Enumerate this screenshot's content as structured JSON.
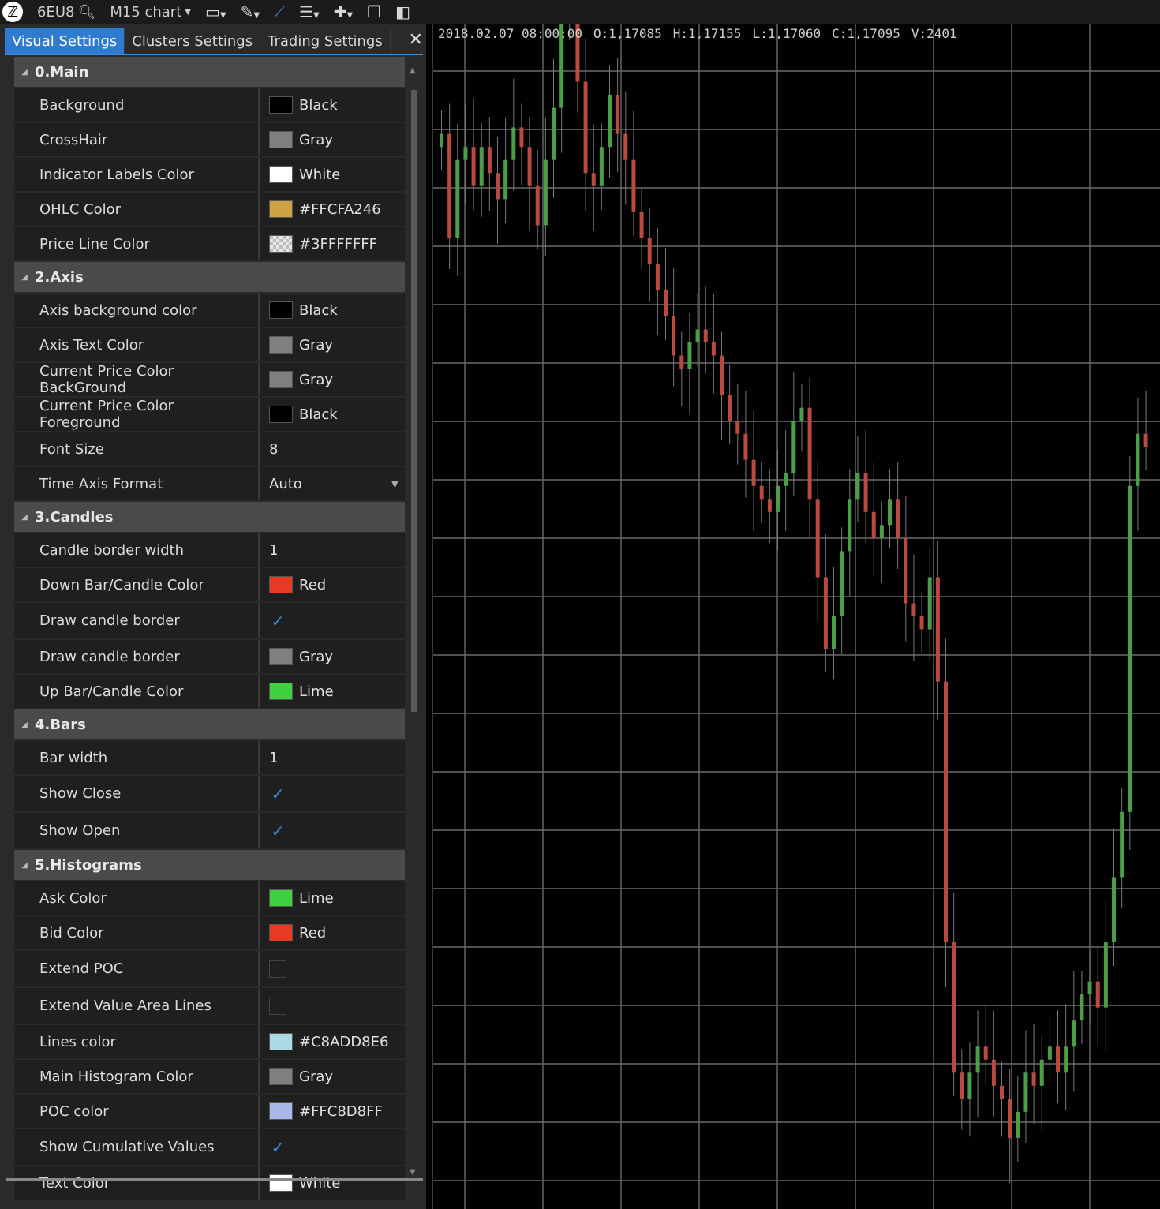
{
  "toolbar": {
    "instrument": "6EU8",
    "chart_label": "M15 chart",
    "icons": [
      "logo-icon",
      "search-icon",
      "display-icon",
      "pencil-icon",
      "chart-line-icon",
      "align-icon",
      "crosshair-plus-icon",
      "window-icon",
      "layout-icon"
    ]
  },
  "panel": {
    "tabs": [
      "Visual Settings",
      "Clusters Settings",
      "Trading Settings"
    ],
    "active_tab": "Visual Settings",
    "sections": [
      {
        "title": "0.Main",
        "rows": [
          {
            "label": "Background",
            "type": "color",
            "value": "Black",
            "color": "#000000"
          },
          {
            "label": "CrossHair",
            "type": "color",
            "value": "Gray",
            "color": "#808080"
          },
          {
            "label": "Indicator Labels Color",
            "type": "color",
            "value": "White",
            "color": "#ffffff"
          },
          {
            "label": "OHLC Color",
            "type": "color",
            "value": "#FFCFA246",
            "color": "#cfa246"
          },
          {
            "label": "Price Line Color",
            "type": "color",
            "value": "#3FFFFFFF",
            "color": "checker"
          }
        ]
      },
      {
        "title": "2.Axis",
        "rows": [
          {
            "label": "Axis background color",
            "type": "color",
            "value": "Black",
            "color": "#000000"
          },
          {
            "label": "Axis Text Color",
            "type": "color",
            "value": "Gray",
            "color": "#808080"
          },
          {
            "label": "Current Price Color BackGround",
            "type": "color",
            "value": "Gray",
            "color": "#808080"
          },
          {
            "label": "Current Price Color Foreground",
            "type": "color",
            "value": "Black",
            "color": "#000000"
          },
          {
            "label": "Font Size",
            "type": "text",
            "value": "8"
          },
          {
            "label": "Time Axis Format",
            "type": "select",
            "value": "Auto"
          }
        ]
      },
      {
        "title": "3.Candles",
        "rows": [
          {
            "label": "Candle border width",
            "type": "text",
            "value": "1"
          },
          {
            "label": "Down Bar/Candle Color",
            "type": "color",
            "value": "Red",
            "color": "#e63a22"
          },
          {
            "label": "Draw candle border",
            "type": "check",
            "checked": true
          },
          {
            "label": "Draw candle border",
            "type": "color",
            "value": "Gray",
            "color": "#808080"
          },
          {
            "label": "Up Bar/Candle Color",
            "type": "color",
            "value": "Lime",
            "color": "#3fd13f"
          }
        ]
      },
      {
        "title": "4.Bars",
        "rows": [
          {
            "label": "Bar width",
            "type": "text",
            "value": "1"
          },
          {
            "label": "Show Close",
            "type": "check",
            "checked": true
          },
          {
            "label": "Show Open",
            "type": "check",
            "checked": true
          }
        ]
      },
      {
        "title": "5.Histograms",
        "rows": [
          {
            "label": "Ask Color",
            "type": "color",
            "value": "Lime",
            "color": "#3fd13f"
          },
          {
            "label": "Bid Color",
            "type": "color",
            "value": "Red",
            "color": "#e63a22"
          },
          {
            "label": "Extend POC",
            "type": "check",
            "checked": false
          },
          {
            "label": "Extend Value Area Lines",
            "type": "check",
            "checked": false
          },
          {
            "label": "Lines color",
            "type": "color",
            "value": "#C8ADD8E6",
            "color": "#add8e6"
          },
          {
            "label": "Main Histogram Color",
            "type": "color",
            "value": "Gray",
            "color": "#808080"
          },
          {
            "label": "POC color",
            "type": "color",
            "value": "#FFC8D8FF",
            "color": "#a8b8e8"
          },
          {
            "label": "Show Cumulative Values",
            "type": "check",
            "checked": true
          },
          {
            "label": "Text Color",
            "type": "color",
            "value": "White",
            "color": "#ffffff"
          }
        ]
      }
    ]
  },
  "chart": {
    "ohlc": {
      "datetime": "2018.02.07 08:00:00",
      "open": "O:1,17085",
      "high": "H:1,17155",
      "low": "L:1,17060",
      "close": "C:1,17095",
      "volume": "V:2401"
    },
    "colors": {
      "up": "#4a9e46",
      "down": "#b84a3e",
      "grid": "#6a6a6a",
      "wick": "#7a7a7a"
    },
    "candles_close": [
      0.74,
      0.58,
      0.7,
      0.72,
      0.66,
      0.72,
      0.68,
      0.64,
      0.7,
      0.75,
      0.72,
      0.66,
      0.6,
      0.7,
      0.78,
      0.95,
      0.92,
      0.82,
      0.68,
      0.66,
      0.72,
      0.8,
      0.74,
      0.7,
      0.62,
      0.58,
      0.54,
      0.5,
      0.46,
      0.4,
      0.38,
      0.42,
      0.44,
      0.42,
      0.4,
      0.34,
      0.3,
      0.28,
      0.24,
      0.2,
      0.18,
      0.16,
      0.2,
      0.22,
      0.3,
      0.32,
      0.18,
      0.06,
      -0.05,
      0.0,
      0.1,
      0.18,
      0.22,
      0.16,
      0.12,
      0.14,
      0.18,
      0.12,
      0.02,
      0.0,
      -0.02,
      0.06,
      -0.1,
      -0.5,
      -0.7,
      -0.74,
      -0.7,
      -0.66,
      -0.68,
      -0.72,
      -0.74,
      -0.8,
      -0.76,
      -0.7,
      -0.72,
      -0.68,
      -0.66,
      -0.7,
      -0.66,
      -0.62,
      -0.58,
      -0.56,
      -0.6,
      -0.5,
      -0.4,
      -0.3,
      0.2,
      0.28,
      0.26
    ]
  }
}
